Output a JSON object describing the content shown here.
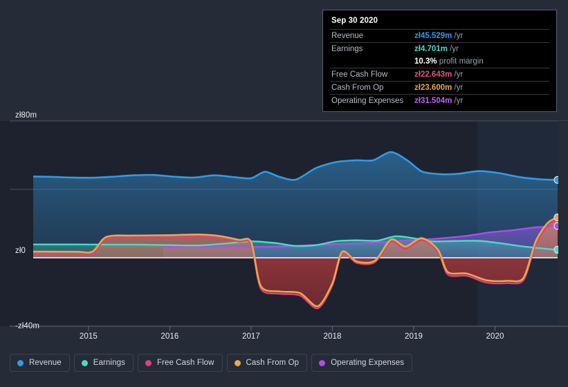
{
  "chart_data": {
    "type": "area",
    "title": "",
    "xlabel": "",
    "ylabel": "",
    "currency_symbol": "zł",
    "unit": "m",
    "ylim": [
      -40,
      80
    ],
    "ytick_labels": [
      "zł80m",
      "zł0",
      "-zł40m"
    ],
    "ytick_values": [
      80,
      0,
      -40
    ],
    "gridlines": [
      "zł80m",
      "zł40m",
      "zł0",
      "-zł40m"
    ],
    "xtick_labels": [
      "2015",
      "2016",
      "2017",
      "2018",
      "2019",
      "2020"
    ],
    "xtick_values": [
      2015,
      2016,
      2017,
      2018,
      2019,
      2020
    ],
    "x_range": [
      2014.32,
      2020.77
    ],
    "legend_position": "bottom-left",
    "series": [
      {
        "name": "Revenue",
        "color": "#2e9ce8",
        "values": [
          {
            "x": 2014.32,
            "y": 47.5
          },
          {
            "x": 2014.55,
            "y": 47.3
          },
          {
            "x": 2014.8,
            "y": 46.9
          },
          {
            "x": 2015.05,
            "y": 46.8
          },
          {
            "x": 2015.3,
            "y": 47.4
          },
          {
            "x": 2015.55,
            "y": 48.2
          },
          {
            "x": 2015.8,
            "y": 48.4
          },
          {
            "x": 2016.05,
            "y": 47.4
          },
          {
            "x": 2016.3,
            "y": 46.9
          },
          {
            "x": 2016.55,
            "y": 48.2
          },
          {
            "x": 2016.8,
            "y": 47.1
          },
          {
            "x": 2017.0,
            "y": 46.5
          },
          {
            "x": 2017.17,
            "y": 50.3
          },
          {
            "x": 2017.35,
            "y": 47.3
          },
          {
            "x": 2017.55,
            "y": 45.7
          },
          {
            "x": 2017.8,
            "y": 52.5
          },
          {
            "x": 2018.05,
            "y": 56.0
          },
          {
            "x": 2018.3,
            "y": 57.0
          },
          {
            "x": 2018.5,
            "y": 57.0
          },
          {
            "x": 2018.72,
            "y": 61.8
          },
          {
            "x": 2018.92,
            "y": 57.0
          },
          {
            "x": 2019.1,
            "y": 50.5
          },
          {
            "x": 2019.32,
            "y": 48.9
          },
          {
            "x": 2019.55,
            "y": 49.1
          },
          {
            "x": 2019.8,
            "y": 50.7
          },
          {
            "x": 2020.05,
            "y": 49.5
          },
          {
            "x": 2020.3,
            "y": 47.2
          },
          {
            "x": 2020.55,
            "y": 45.9
          },
          {
            "x": 2020.77,
            "y": 45.529
          }
        ]
      },
      {
        "name": "Earnings",
        "color": "#4bdbc3",
        "values": [
          {
            "x": 2014.32,
            "y": 7.8
          },
          {
            "x": 2014.8,
            "y": 7.8
          },
          {
            "x": 2015.2,
            "y": 7.7
          },
          {
            "x": 2015.6,
            "y": 7.7
          },
          {
            "x": 2016.0,
            "y": 7.4
          },
          {
            "x": 2016.35,
            "y": 7.2
          },
          {
            "x": 2016.7,
            "y": 8.4
          },
          {
            "x": 2017.0,
            "y": 9.6
          },
          {
            "x": 2017.3,
            "y": 8.6
          },
          {
            "x": 2017.55,
            "y": 6.9
          },
          {
            "x": 2017.8,
            "y": 7.4
          },
          {
            "x": 2018.05,
            "y": 9.7
          },
          {
            "x": 2018.3,
            "y": 10.2
          },
          {
            "x": 2018.55,
            "y": 10.0
          },
          {
            "x": 2018.78,
            "y": 12.6
          },
          {
            "x": 2019.0,
            "y": 11.4
          },
          {
            "x": 2019.22,
            "y": 9.6
          },
          {
            "x": 2019.5,
            "y": 9.8
          },
          {
            "x": 2019.8,
            "y": 9.9
          },
          {
            "x": 2020.05,
            "y": 8.6
          },
          {
            "x": 2020.3,
            "y": 6.9
          },
          {
            "x": 2020.55,
            "y": 5.6
          },
          {
            "x": 2020.77,
            "y": 4.701
          }
        ]
      },
      {
        "name": "Free Cash Flow",
        "color": "#d8437f",
        "values": [
          {
            "x": 2014.32,
            "y": 2.4
          },
          {
            "x": 2014.85,
            "y": 2.4
          },
          {
            "x": 2015.05,
            "y": 2.5
          },
          {
            "x": 2015.22,
            "y": 11.2
          },
          {
            "x": 2015.55,
            "y": 12.0
          },
          {
            "x": 2016.0,
            "y": 12.3
          },
          {
            "x": 2016.35,
            "y": 12.6
          },
          {
            "x": 2016.6,
            "y": 11.8
          },
          {
            "x": 2016.85,
            "y": 9.5
          },
          {
            "x": 2017.0,
            "y": 8.2
          },
          {
            "x": 2017.12,
            "y": -18.0
          },
          {
            "x": 2017.35,
            "y": -21.0
          },
          {
            "x": 2017.6,
            "y": -22.0
          },
          {
            "x": 2017.82,
            "y": -29.5
          },
          {
            "x": 2018.0,
            "y": -16.0
          },
          {
            "x": 2018.12,
            "y": 2.6
          },
          {
            "x": 2018.3,
            "y": -3.0
          },
          {
            "x": 2018.52,
            "y": -2.6
          },
          {
            "x": 2018.72,
            "y": 9.4
          },
          {
            "x": 2018.9,
            "y": 5.3
          },
          {
            "x": 2019.1,
            "y": 10.3
          },
          {
            "x": 2019.3,
            "y": 3.5
          },
          {
            "x": 2019.42,
            "y": -9.8
          },
          {
            "x": 2019.65,
            "y": -10.5
          },
          {
            "x": 2019.9,
            "y": -14.5
          },
          {
            "x": 2020.15,
            "y": -14.8
          },
          {
            "x": 2020.35,
            "y": -13.0
          },
          {
            "x": 2020.5,
            "y": 8.0
          },
          {
            "x": 2020.65,
            "y": 19.0
          },
          {
            "x": 2020.77,
            "y": 22.643
          }
        ]
      },
      {
        "name": "Cash From Op",
        "color": "#eda83f",
        "values": [
          {
            "x": 2014.32,
            "y": 3.6
          },
          {
            "x": 2014.85,
            "y": 3.5
          },
          {
            "x": 2015.05,
            "y": 3.6
          },
          {
            "x": 2015.22,
            "y": 12.2
          },
          {
            "x": 2015.55,
            "y": 13.0
          },
          {
            "x": 2016.0,
            "y": 13.2
          },
          {
            "x": 2016.35,
            "y": 13.6
          },
          {
            "x": 2016.6,
            "y": 12.8
          },
          {
            "x": 2016.85,
            "y": 10.5
          },
          {
            "x": 2017.0,
            "y": 9.2
          },
          {
            "x": 2017.12,
            "y": -16.6
          },
          {
            "x": 2017.35,
            "y": -19.7
          },
          {
            "x": 2017.6,
            "y": -20.6
          },
          {
            "x": 2017.82,
            "y": -28.3
          },
          {
            "x": 2018.0,
            "y": -14.8
          },
          {
            "x": 2018.12,
            "y": 3.5
          },
          {
            "x": 2018.3,
            "y": -2.2
          },
          {
            "x": 2018.52,
            "y": -1.8
          },
          {
            "x": 2018.72,
            "y": 10.6
          },
          {
            "x": 2018.9,
            "y": 6.6
          },
          {
            "x": 2019.1,
            "y": 11.5
          },
          {
            "x": 2019.3,
            "y": 4.6
          },
          {
            "x": 2019.42,
            "y": -8.4
          },
          {
            "x": 2019.65,
            "y": -9.2
          },
          {
            "x": 2019.9,
            "y": -13.2
          },
          {
            "x": 2020.15,
            "y": -13.5
          },
          {
            "x": 2020.35,
            "y": -11.8
          },
          {
            "x": 2020.5,
            "y": 9.5
          },
          {
            "x": 2020.65,
            "y": 20.5
          },
          {
            "x": 2020.77,
            "y": 23.6
          }
        ]
      },
      {
        "name": "Operating Expenses",
        "color": "#b24ce8",
        "values": [
          {
            "x": 2015.92,
            "y": 6.5
          },
          {
            "x": 2016.2,
            "y": 6.6
          },
          {
            "x": 2016.5,
            "y": 6.7
          },
          {
            "x": 2016.85,
            "y": 6.8
          },
          {
            "x": 2017.05,
            "y": 6.4
          },
          {
            "x": 2017.35,
            "y": 6.6
          },
          {
            "x": 2017.7,
            "y": 7.3
          },
          {
            "x": 2018.05,
            "y": 8.0
          },
          {
            "x": 2018.4,
            "y": 8.6
          },
          {
            "x": 2018.75,
            "y": 9.6
          },
          {
            "x": 2019.05,
            "y": 10.4
          },
          {
            "x": 2019.35,
            "y": 11.4
          },
          {
            "x": 2019.65,
            "y": 12.8
          },
          {
            "x": 2019.95,
            "y": 14.9
          },
          {
            "x": 2020.25,
            "y": 16.3
          },
          {
            "x": 2020.5,
            "y": 17.8
          },
          {
            "x": 2020.77,
            "y": 18.6
          }
        ]
      }
    ]
  },
  "tooltip": {
    "title": "Sep 30 2020",
    "rows": [
      {
        "label": "Revenue",
        "value": "zł45.529m",
        "unit": "/yr",
        "color": "#2e9ce8"
      },
      {
        "label": "Earnings",
        "value": "zł4.701m",
        "unit": "/yr",
        "color": "#4bdbc3"
      },
      {
        "label": "",
        "value": "10.3%",
        "unit": "profit margin",
        "color": "#ffffff"
      },
      {
        "label": "Free Cash Flow",
        "value": "zł22.643m",
        "unit": "/yr",
        "color": "#e0538c"
      },
      {
        "label": "Cash From Op",
        "value": "zł23.600m",
        "unit": "/yr",
        "color": "#eda83f"
      },
      {
        "label": "Operating Expenses",
        "value": "zł31.504m",
        "unit": "/yr",
        "color": "#c55ef5"
      }
    ]
  },
  "legend": {
    "items": [
      {
        "label": "Revenue",
        "color": "#2e9ce8"
      },
      {
        "label": "Earnings",
        "color": "#4bdbc3"
      },
      {
        "label": "Free Cash Flow",
        "color": "#d8437f"
      },
      {
        "label": "Cash From Op",
        "color": "#eda83f"
      },
      {
        "label": "Operating Expenses",
        "color": "#b24ce8"
      }
    ]
  }
}
